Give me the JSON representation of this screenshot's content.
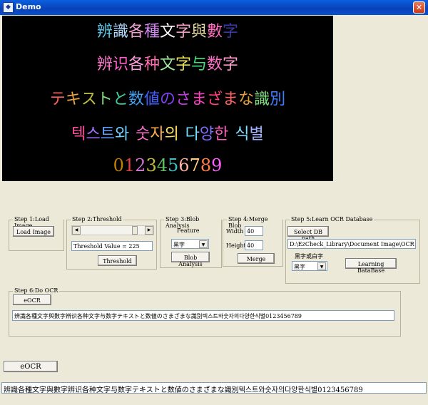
{
  "window": {
    "title": "Demo",
    "icon": "app-icon",
    "close": "✕"
  },
  "image": {
    "lines": [
      {
        "text": "辨識各種文字與數字",
        "colors": [
          "#5fc8e8",
          "#b0d8ff",
          "#f0a0d0",
          "#d08af0",
          "#ffffff",
          "#f0a0c0",
          "#e8d8a0",
          "#ff70c0",
          "#3a3aa0"
        ]
      },
      {
        "text": "辨识各种文字与数字",
        "colors": [
          "#ff7ad0",
          "#ff60c8",
          "#ffa0e0",
          "#ff70b0",
          "#a0e8a0",
          "#e8e060",
          "#40e080",
          "#ff70c8",
          "#ffa0d0"
        ]
      },
      {
        "text": "テキストと数値のさまざまな識別",
        "colors": [
          "#ff6060",
          "#e8a040",
          "#c0c040",
          "#80e080",
          "#40d0a0",
          "#40a0f0",
          "#4060ff",
          "#8040f0",
          "#c040e0",
          "#ff40c0",
          "#ff4080",
          "#ff6060",
          "#e0a040",
          "#80e080",
          "#4080ff"
        ]
      },
      {
        "text": "텍스트와 숫자의 다양한 식별",
        "colors": [
          "#ff50a0",
          "#a070ff",
          "#60a0ff",
          "#70d0ff",
          "#000000",
          "#ff70d0",
          "#ffb050",
          "#ffe060",
          "#000000",
          "#70e0ff",
          "#8070ff",
          "#ff60c0",
          "#000000",
          "#80e0ff",
          "#a0b0ff"
        ]
      },
      {
        "text": "0123456789",
        "colors": [
          "#c08000",
          "#e04040",
          "#d070d0",
          "#c0c040",
          "#60c060",
          "#40c0c0",
          "#ffb0a0",
          "#ffd080",
          "#ff8040",
          "#ff60ff"
        ]
      }
    ]
  },
  "step1": {
    "legend": "Step 1:Load Image",
    "load_label": "Load Image"
  },
  "step2": {
    "legend": "Step 2:Threshold",
    "threshold_value": "Threshold Value = 225",
    "threshold_label": "Threshold"
  },
  "step3": {
    "legend": "Step 3:Blob Analysis",
    "feature_label": "Feature",
    "feature_value": "黑字",
    "blob_label": "Blob Analysis"
  },
  "step4": {
    "legend": "Step 4:Merge Blob",
    "width_label": "Width",
    "width_value": "40",
    "height_label": "Height",
    "height_value": "40",
    "merge_label": "Merge"
  },
  "step5": {
    "legend": "Step 5:Learn OCR Database",
    "select_db_label": "Select DB path",
    "db_path": "D:\\EzCheck_Library\\Document Image\\OCR demo",
    "color_label": "黑字或白字",
    "color_value": "黑字",
    "learn_label": "Learning BataBase"
  },
  "step6": {
    "legend": "Step 6:Do OCR",
    "eocr_label": "eOCR",
    "result": "辨識各種文字與數字辨识各种文字与数字テキストと数値のさまざまな識別텍스트와숫자의다양한식별0123456789"
  },
  "bottom": {
    "eocr_label": "eOCR",
    "result": "辨識各種文字與數字辨识各种文字与数字テキストと数値のさまざまな識別텍스트와숫자의다양한식별0123456789"
  }
}
